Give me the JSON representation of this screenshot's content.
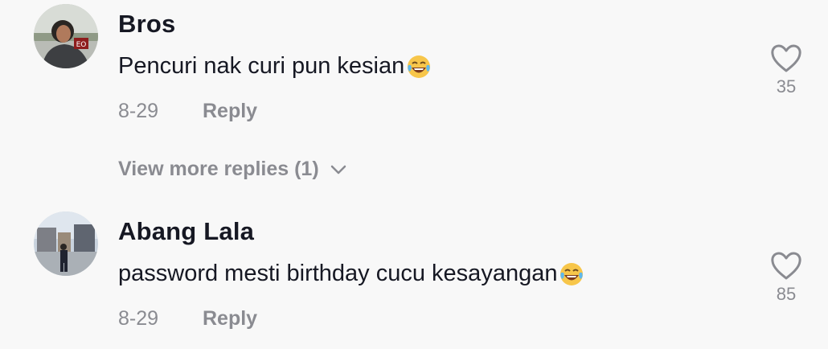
{
  "comments": [
    {
      "username": "Bros",
      "text": "Pencuri nak curi pun kesian",
      "emoji": "face-with-tears-of-joy",
      "date": "8-29",
      "reply_label": "Reply",
      "like_count": "35"
    },
    {
      "username": "Abang Lala",
      "text": "password mesti birthday cucu kesayangan",
      "emoji": "face-with-tears-of-joy",
      "date": "8-29",
      "reply_label": "Reply",
      "like_count": "85"
    }
  ],
  "view_more_replies": {
    "label": "View more replies (1)",
    "icon": "chevron-down-icon"
  },
  "colors": {
    "background": "#f8f8f8",
    "primary_text": "#161823",
    "secondary_text": "#8a8b91"
  }
}
